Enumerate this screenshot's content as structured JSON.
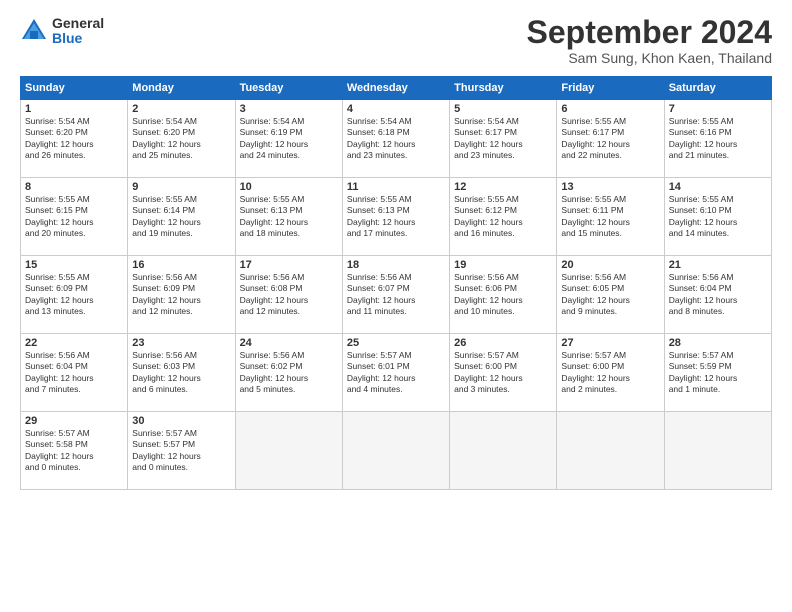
{
  "logo": {
    "general": "General",
    "blue": "Blue"
  },
  "title": "September 2024",
  "location": "Sam Sung, Khon Kaen, Thailand",
  "days_header": [
    "Sunday",
    "Monday",
    "Tuesday",
    "Wednesday",
    "Thursday",
    "Friday",
    "Saturday"
  ],
  "weeks": [
    [
      {
        "day": "1",
        "info": "Sunrise: 5:54 AM\nSunset: 6:20 PM\nDaylight: 12 hours\nand 26 minutes."
      },
      {
        "day": "2",
        "info": "Sunrise: 5:54 AM\nSunset: 6:20 PM\nDaylight: 12 hours\nand 25 minutes."
      },
      {
        "day": "3",
        "info": "Sunrise: 5:54 AM\nSunset: 6:19 PM\nDaylight: 12 hours\nand 24 minutes."
      },
      {
        "day": "4",
        "info": "Sunrise: 5:54 AM\nSunset: 6:18 PM\nDaylight: 12 hours\nand 23 minutes."
      },
      {
        "day": "5",
        "info": "Sunrise: 5:54 AM\nSunset: 6:17 PM\nDaylight: 12 hours\nand 23 minutes."
      },
      {
        "day": "6",
        "info": "Sunrise: 5:55 AM\nSunset: 6:17 PM\nDaylight: 12 hours\nand 22 minutes."
      },
      {
        "day": "7",
        "info": "Sunrise: 5:55 AM\nSunset: 6:16 PM\nDaylight: 12 hours\nand 21 minutes."
      }
    ],
    [
      {
        "day": "8",
        "info": "Sunrise: 5:55 AM\nSunset: 6:15 PM\nDaylight: 12 hours\nand 20 minutes."
      },
      {
        "day": "9",
        "info": "Sunrise: 5:55 AM\nSunset: 6:14 PM\nDaylight: 12 hours\nand 19 minutes."
      },
      {
        "day": "10",
        "info": "Sunrise: 5:55 AM\nSunset: 6:13 PM\nDaylight: 12 hours\nand 18 minutes."
      },
      {
        "day": "11",
        "info": "Sunrise: 5:55 AM\nSunset: 6:13 PM\nDaylight: 12 hours\nand 17 minutes."
      },
      {
        "day": "12",
        "info": "Sunrise: 5:55 AM\nSunset: 6:12 PM\nDaylight: 12 hours\nand 16 minutes."
      },
      {
        "day": "13",
        "info": "Sunrise: 5:55 AM\nSunset: 6:11 PM\nDaylight: 12 hours\nand 15 minutes."
      },
      {
        "day": "14",
        "info": "Sunrise: 5:55 AM\nSunset: 6:10 PM\nDaylight: 12 hours\nand 14 minutes."
      }
    ],
    [
      {
        "day": "15",
        "info": "Sunrise: 5:55 AM\nSunset: 6:09 PM\nDaylight: 12 hours\nand 13 minutes."
      },
      {
        "day": "16",
        "info": "Sunrise: 5:56 AM\nSunset: 6:09 PM\nDaylight: 12 hours\nand 12 minutes."
      },
      {
        "day": "17",
        "info": "Sunrise: 5:56 AM\nSunset: 6:08 PM\nDaylight: 12 hours\nand 12 minutes."
      },
      {
        "day": "18",
        "info": "Sunrise: 5:56 AM\nSunset: 6:07 PM\nDaylight: 12 hours\nand 11 minutes."
      },
      {
        "day": "19",
        "info": "Sunrise: 5:56 AM\nSunset: 6:06 PM\nDaylight: 12 hours\nand 10 minutes."
      },
      {
        "day": "20",
        "info": "Sunrise: 5:56 AM\nSunset: 6:05 PM\nDaylight: 12 hours\nand 9 minutes."
      },
      {
        "day": "21",
        "info": "Sunrise: 5:56 AM\nSunset: 6:04 PM\nDaylight: 12 hours\nand 8 minutes."
      }
    ],
    [
      {
        "day": "22",
        "info": "Sunrise: 5:56 AM\nSunset: 6:04 PM\nDaylight: 12 hours\nand 7 minutes."
      },
      {
        "day": "23",
        "info": "Sunrise: 5:56 AM\nSunset: 6:03 PM\nDaylight: 12 hours\nand 6 minutes."
      },
      {
        "day": "24",
        "info": "Sunrise: 5:56 AM\nSunset: 6:02 PM\nDaylight: 12 hours\nand 5 minutes."
      },
      {
        "day": "25",
        "info": "Sunrise: 5:57 AM\nSunset: 6:01 PM\nDaylight: 12 hours\nand 4 minutes."
      },
      {
        "day": "26",
        "info": "Sunrise: 5:57 AM\nSunset: 6:00 PM\nDaylight: 12 hours\nand 3 minutes."
      },
      {
        "day": "27",
        "info": "Sunrise: 5:57 AM\nSunset: 6:00 PM\nDaylight: 12 hours\nand 2 minutes."
      },
      {
        "day": "28",
        "info": "Sunrise: 5:57 AM\nSunset: 5:59 PM\nDaylight: 12 hours\nand 1 minute."
      }
    ],
    [
      {
        "day": "29",
        "info": "Sunrise: 5:57 AM\nSunset: 5:58 PM\nDaylight: 12 hours\nand 0 minutes."
      },
      {
        "day": "30",
        "info": "Sunrise: 5:57 AM\nSunset: 5:57 PM\nDaylight: 12 hours\nand 0 minutes."
      },
      {
        "day": "",
        "info": ""
      },
      {
        "day": "",
        "info": ""
      },
      {
        "day": "",
        "info": ""
      },
      {
        "day": "",
        "info": ""
      },
      {
        "day": "",
        "info": ""
      }
    ]
  ]
}
